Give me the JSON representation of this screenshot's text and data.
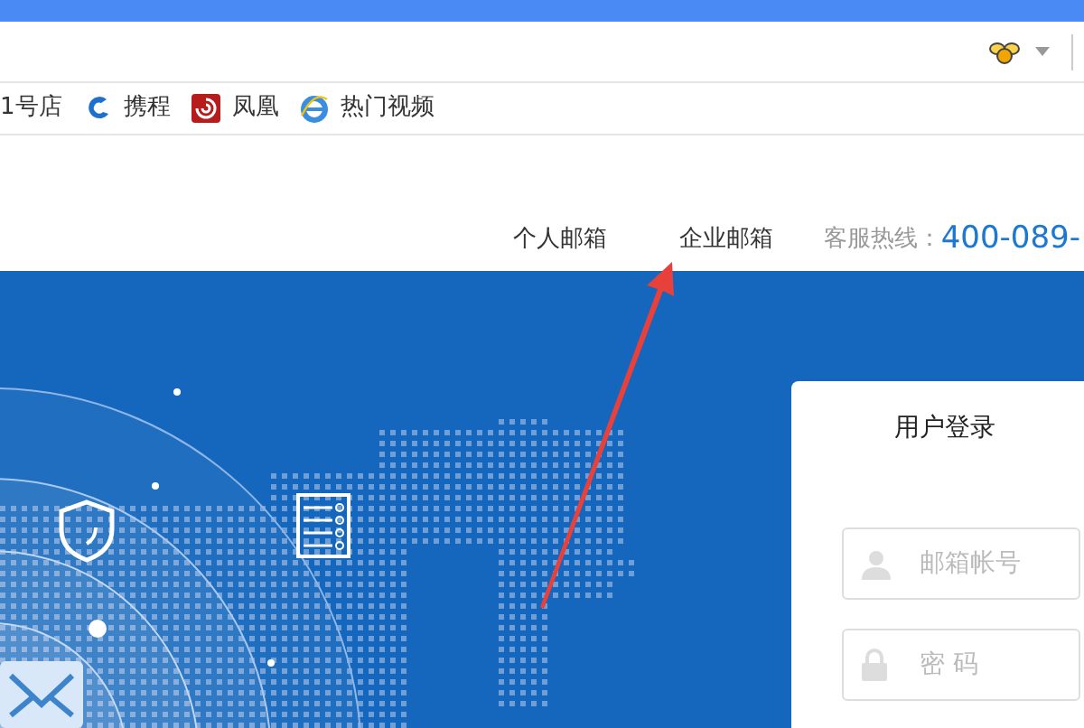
{
  "browser": {
    "bookmarks": [
      {
        "label": "1号店",
        "kind": "none"
      },
      {
        "label": "携程",
        "kind": "swirl"
      },
      {
        "label": "凤凰",
        "kind": "square"
      },
      {
        "label": "热门视频",
        "kind": "ie"
      }
    ]
  },
  "nav": {
    "links": [
      {
        "label": "个人邮箱"
      },
      {
        "label": "企业邮箱"
      }
    ],
    "hotline_label": "客服热线：",
    "hotline": "400-089-"
  },
  "login": {
    "title": "用户登录",
    "fields": [
      {
        "kind": "account",
        "placeholder": "邮箱帐号"
      },
      {
        "kind": "password",
        "placeholder": "密 码"
      }
    ]
  }
}
